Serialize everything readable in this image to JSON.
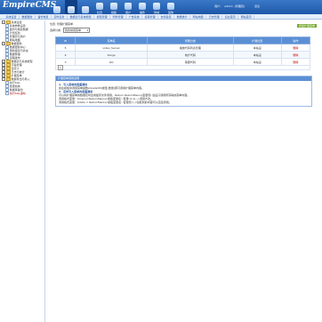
{
  "header": {
    "logo_main": "EmpireCMS",
    "logo_sub": "",
    "icons": [
      {
        "name": "home-icon",
        "label": "",
        "selected": false
      },
      {
        "name": "system-icon",
        "label": "",
        "selected": true
      },
      {
        "name": "info-icon",
        "label": "",
        "selected": false
      },
      {
        "name": "column-icon",
        "label": "栏目",
        "selected": false
      },
      {
        "name": "template-icon",
        "label": "模板",
        "selected": false
      },
      {
        "name": "user-icon",
        "label": "用户",
        "selected": false
      },
      {
        "name": "plugin-icon",
        "label": "插件",
        "selected": false
      },
      {
        "name": "shop-icon",
        "label": "商城",
        "selected": false
      },
      {
        "name": "other-icon",
        "label": "其他",
        "selected": false
      }
    ],
    "user_label": "用户：",
    "username": "admin",
    "role": "[管理员]",
    "links": "退出"
  },
  "subnav": [
    "系统设置",
    "数据更新",
    "备份恢复",
    "定时任务",
    "数据表与系统模型",
    "模型管理",
    "附件管理",
    "广告系统",
    "投票管理",
    "友情链接",
    "数据统计",
    "网站地图",
    "日志管理",
    "后台首页",
    "网站首页"
  ],
  "sidebar": {
    "items": [
      {
        "label": "系统设置",
        "level": 0,
        "type": "fold"
      },
      {
        "label": "系统参数设置",
        "level": 1,
        "type": "doc"
      },
      {
        "label": "备份与恢复数据",
        "level": 1,
        "type": "doc"
      },
      {
        "label": "计划任务",
        "level": 1,
        "type": "doc"
      },
      {
        "label": "管理员与用户",
        "level": 1,
        "type": "doc"
      },
      {
        "label": "网站地图",
        "level": 1,
        "type": "doc"
      },
      {
        "label": "数据更新",
        "level": 0,
        "type": "fold"
      },
      {
        "label": "数据更新中心",
        "level": 1,
        "type": "doc"
      },
      {
        "label": "更新缓存与状态",
        "level": 1,
        "type": "doc"
      },
      {
        "label": "数据整理",
        "level": 1,
        "type": "doc"
      },
      {
        "label": "远程发布",
        "level": 1,
        "type": "doc"
      },
      {
        "label": "数据表与系统模型",
        "level": 0,
        "type": "fold"
      },
      {
        "label": "字段管理",
        "level": 0,
        "type": "fold"
      },
      {
        "label": "自定义",
        "level": 0,
        "type": "fold"
      },
      {
        "label": "日志与统计",
        "level": 0,
        "type": "fold"
      },
      {
        "label": "扩展菜单",
        "level": 0,
        "type": "fold"
      },
      {
        "label": "数据导出与导入",
        "level": 0,
        "type": "fold"
      },
      {
        "label": "执行SQL",
        "level": 1,
        "type": "doc"
      },
      {
        "label": "批量替换",
        "level": 1,
        "type": "doc"
      },
      {
        "label": "数据库备份",
        "level": 1,
        "type": "doc"
      },
      {
        "label": "执行SQL语句",
        "level": 1,
        "type": "doc",
        "active": true
      }
    ]
  },
  "main": {
    "position": "位置: 管理扩展菜单",
    "add_button": "增加扩展菜单",
    "filter_label": "选择分类:",
    "filter_value": "我的常用菜单",
    "table": {
      "headers": [
        "ID",
        "菜单名",
        "所属分类",
        "扩展位置",
        "操作"
      ],
      "rows": [
        [
          "5",
          "video_Server",
          "播放代码列表管理",
          "本站设",
          "删除"
        ],
        [
          "4",
          "Songs",
          "统计代码",
          "本站设",
          "删除"
        ],
        [
          "3",
          "QQ",
          "客服代码",
          "本站设",
          "删除"
        ]
      ]
    },
    "footer_button": "»"
  },
  "notice": {
    "title": "扩展菜单调用说明",
    "lines": [
      {
        "cls": "h",
        "text": "1、写入菜单的变量调用"
      },
      {
        "cls": "code",
        "text": "如在模板中调用菜单函数showGCM(类型,数量)即可调用扩展菜单内容。"
      },
      {
        "cls": "h",
        "text": "2、定时写入菜单的变量调用"
      },
      {
        "cls": "code",
        "text": "可以将扩展菜单的数据定时生成缓存文件调用，Return  ReturnMeniu(变量值) 最后只调用所获得的菜单内容。"
      },
      {
        "cls": "code",
        "text": "调用格式变量：$menu=ReturnMeniu('模板变量名','变量',0,1)-->调用方法。"
      },
      {
        "cls": "code",
        "text": "调用格式变量：$data = ReturnMeniu('模板变量名','变量值'); //读取到的内容可以直接调用。"
      }
    ]
  }
}
